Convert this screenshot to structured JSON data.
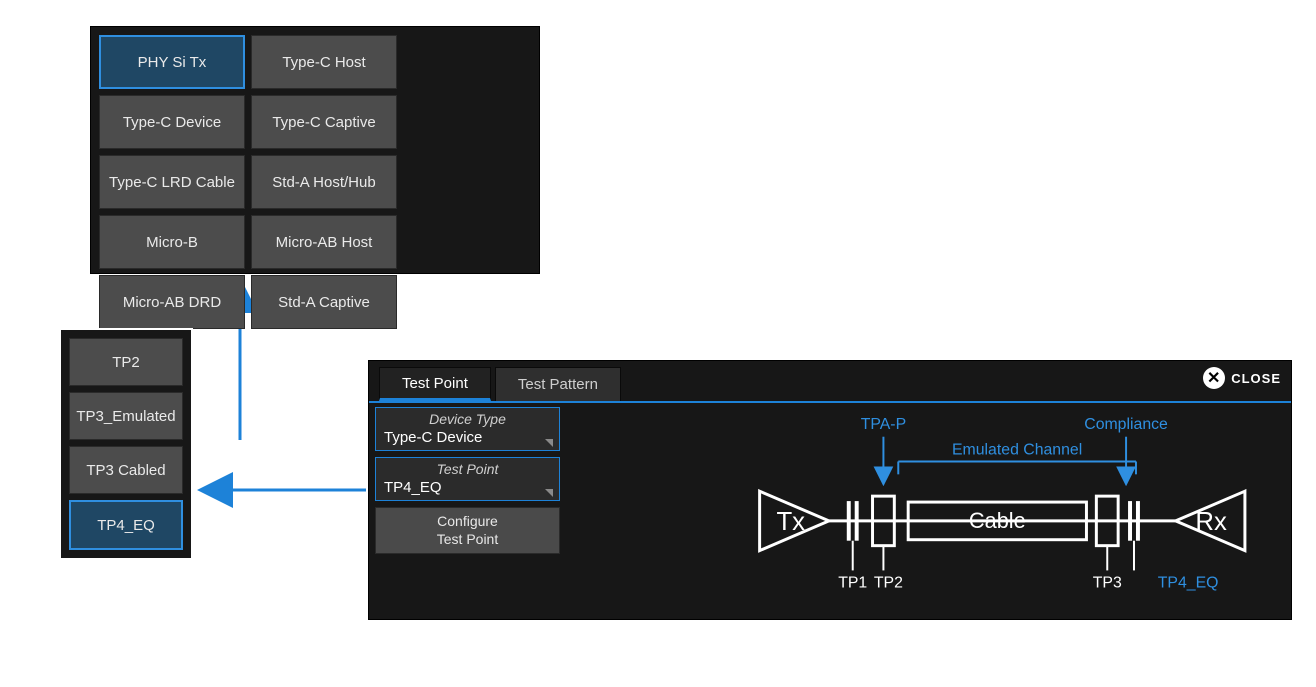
{
  "device_type_popup": {
    "options": [
      "PHY Si Tx",
      "Type-C Host",
      "Type-C Device",
      "Type-C Captive",
      "Type-C LRD Cable",
      "Std-A Host/Hub",
      "Micro-B",
      "Micro-AB Host",
      "Micro-AB DRD",
      "Std-A Captive"
    ],
    "selected_index": 0
  },
  "test_point_popup": {
    "options": [
      "TP2",
      "TP3_Emulated",
      "TP3 Cabled",
      "TP4_EQ"
    ],
    "selected_index": 3
  },
  "panel": {
    "tabs": {
      "items": [
        "Test Point",
        "Test Pattern"
      ],
      "active_index": 0
    },
    "close_label": "CLOSE",
    "sidebar": {
      "device_type": {
        "label": "Device Type",
        "value": "Type-C Device"
      },
      "test_point": {
        "label": "Test Point",
        "value": "TP4_EQ"
      },
      "configure_button": "Configure\nTest Point"
    },
    "diagram": {
      "tpa_p": "TPA-P",
      "compliance": "Compliance",
      "emulated_channel": "Emulated Channel",
      "tx": "Tx",
      "rx": "Rx",
      "cable": "Cable",
      "tp1": "TP1",
      "tp2": "TP2",
      "tp3": "TP3",
      "tp4_eq": "TP4_EQ"
    }
  },
  "colors": {
    "accent": "#1d82d8",
    "accent_light": "#2f8fe0"
  }
}
